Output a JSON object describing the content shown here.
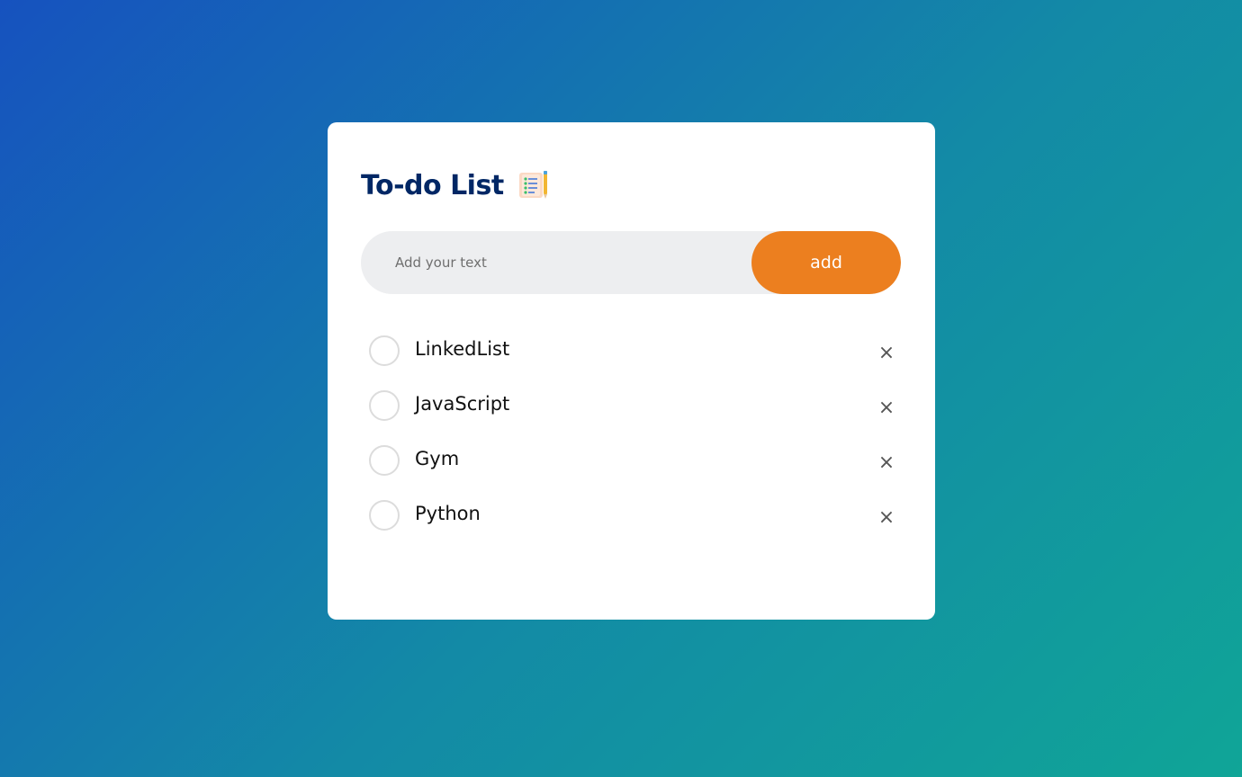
{
  "app": {
    "title": "To-do List",
    "title_icon": "notepad-checklist-icon"
  },
  "input": {
    "placeholder": "Add your text",
    "value": ""
  },
  "add_button": {
    "label": "add",
    "color": "#ec7f1f"
  },
  "colors": {
    "title": "#002765",
    "background_start": "#1652bf",
    "background_end": "#10a597"
  },
  "tasks": [
    {
      "label": "LinkedList",
      "checked": false,
      "remove_label": "×"
    },
    {
      "label": "JavaScript",
      "checked": false,
      "remove_label": "×"
    },
    {
      "label": "Gym",
      "checked": false,
      "remove_label": "×"
    },
    {
      "label": "Python",
      "checked": false,
      "remove_label": "×"
    }
  ]
}
